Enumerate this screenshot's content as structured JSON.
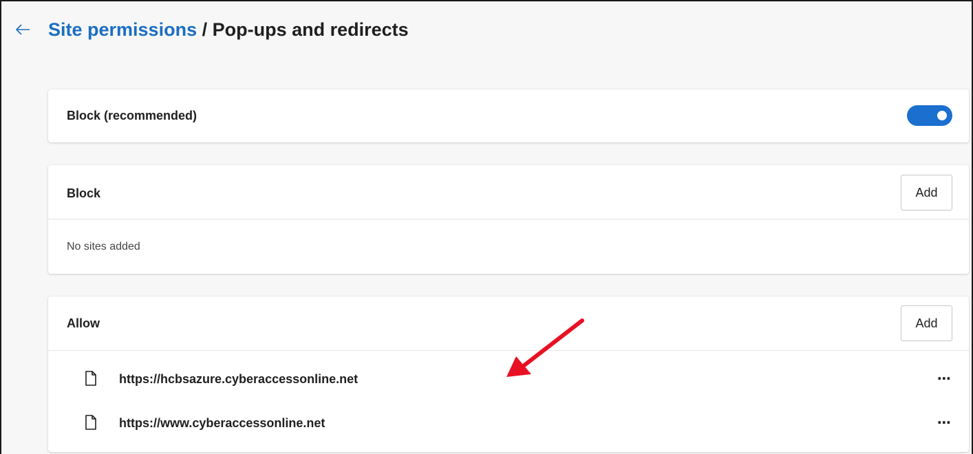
{
  "header": {
    "breadcrumb_link": "Site permissions",
    "breadcrumb_separator": " / ",
    "page_title": "Pop-ups and redirects"
  },
  "block_recommended": {
    "label": "Block (recommended)",
    "toggle_on": true
  },
  "block_section": {
    "label": "Block",
    "add_label": "Add",
    "empty_text": "No sites added"
  },
  "allow_section": {
    "label": "Allow",
    "add_label": "Add",
    "sites": [
      {
        "url": "https://hcbsazure.cyberaccessonline.net",
        "menu": "⋯"
      },
      {
        "url": "https://www.cyberaccessonline.net",
        "menu": "⋯"
      }
    ]
  },
  "icons": {
    "back": "arrow-left-icon",
    "site": "document-icon",
    "more": "more-horizontal-icon"
  },
  "colors": {
    "accent": "#1a6fcf",
    "link": "#1b6ec2",
    "annotation_arrow": "#e81123"
  }
}
